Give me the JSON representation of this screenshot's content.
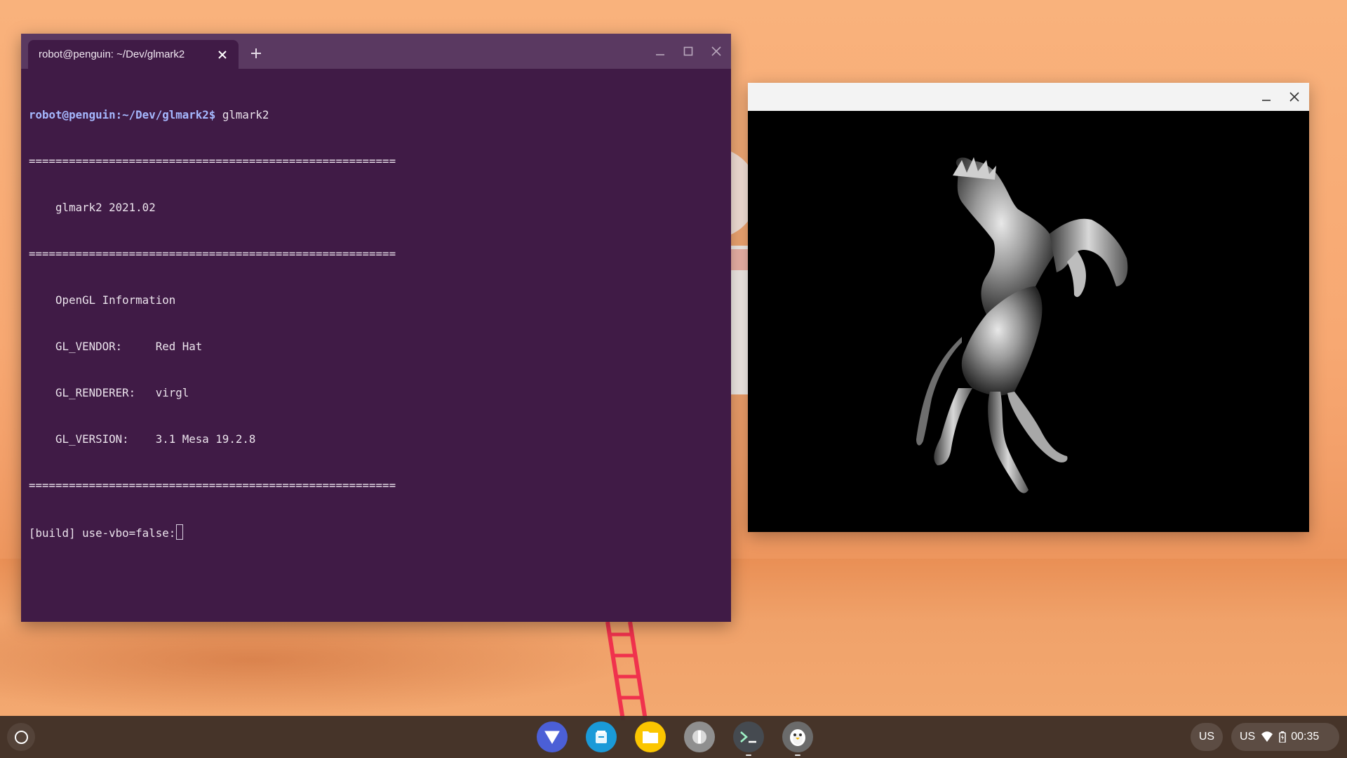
{
  "terminal": {
    "tab_title": "robot@penguin: ~/Dev/glmark2",
    "prompt_user_host": "robot@penguin",
    "prompt_path": ":~/Dev/glmark2$",
    "command": " glmark2",
    "output_lines": [
      "=======================================================",
      "    glmark2 2021.02",
      "=======================================================",
      "    OpenGL Information",
      "    GL_VENDOR:     Red Hat",
      "    GL_RENDERER:   virgl",
      "    GL_VERSION:    3.1 Mesa 19.2.8",
      "======================================================="
    ],
    "last_line": "[build] use-vbo=false:"
  },
  "glmark_window": {
    "scene": "horse-model-render"
  },
  "shelf": {
    "apps": [
      {
        "name": "vectorize-app-icon",
        "color": "#4b5fd6"
      },
      {
        "name": "app-store-icon",
        "color": "#1a9ad8"
      },
      {
        "name": "files-icon",
        "color": "#fbc600"
      },
      {
        "name": "settings-app-icon",
        "color": "#8f8f8f"
      },
      {
        "name": "terminal-icon",
        "color": "#454a50"
      },
      {
        "name": "linux-penguin-icon",
        "color": "#6b6b6b"
      }
    ],
    "ime_label": "US",
    "status_ime": "US",
    "time": "00:35"
  },
  "colors": {
    "terminal_bg": "#401b46",
    "terminal_titlebar": "#5a3961",
    "prompt": "#a6b9ff",
    "desktop_bg": "#f7a872"
  }
}
